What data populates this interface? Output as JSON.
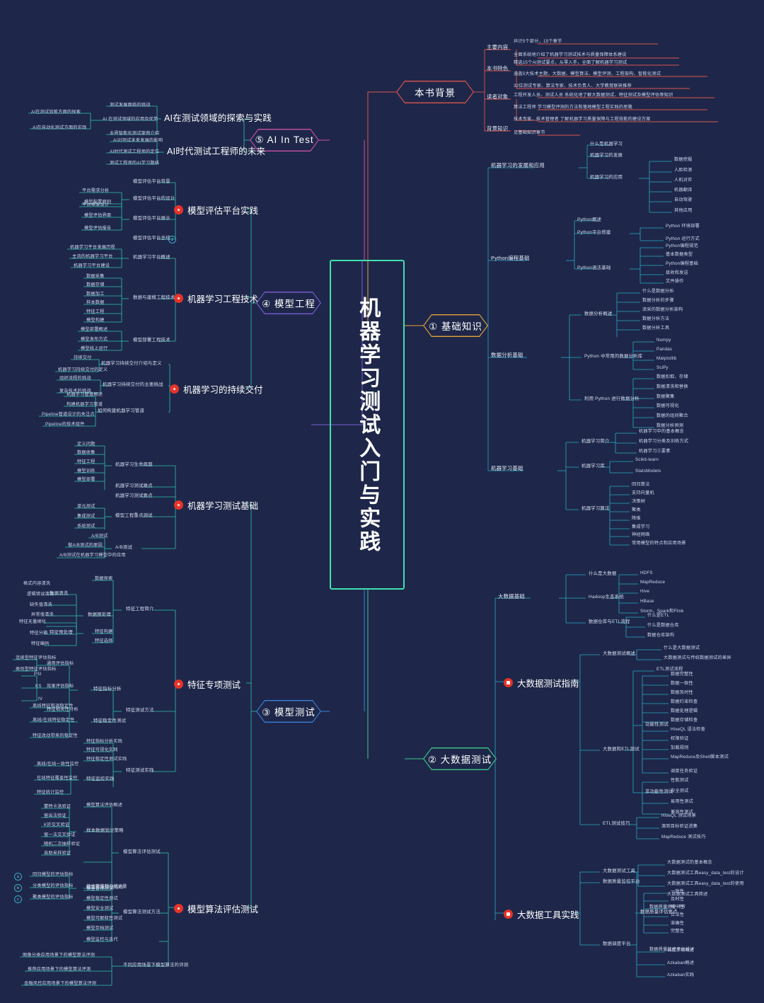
{
  "meta": {
    "title": "机器学习测试入门与实践",
    "bg_color": "#1e2749",
    "center_border_color": "#3fe0b0"
  },
  "center": {
    "label": "机器学习测试入门与实践"
  },
  "branches": [
    {
      "id": "b1",
      "label": "① 基础知识",
      "color": "#e8a13a"
    },
    {
      "id": "b2",
      "label": "② 大数据测试",
      "color": "#3fc98a"
    },
    {
      "id": "b3",
      "label": "③ 模型测试",
      "color": "#3a7fd5"
    },
    {
      "id": "b4",
      "label": "④ 模型工程",
      "color": "#7a5cd8"
    },
    {
      "id": "b5",
      "label": "⑤ AI In Test",
      "color": "#c94fa8"
    },
    {
      "id": "b0",
      "label": "本书背景",
      "color": "#d9544e"
    }
  ],
  "book_background": {
    "title": "本书背景",
    "groups": [
      {
        "label": "主要内容",
        "items": [
          "共计5个部分，15个章节",
          "全面系统地介绍了机器学习测试技术与质量保障体系建设"
        ]
      },
      {
        "label": "本书特色",
        "items": [
          "精选15个AI测试要点，从零入手，全面了解机器学习测试",
          "涵盖5大技术主题，大数据、模型算法、模型评测、工程架构、智能化测试",
          "32位测试专家、算法专家、技术负责人、大学教授联袂推荐"
        ]
      },
      {
        "label": "读者对象",
        "items": [
          "工程开发人员、测试人员      系统化地了解大数据测试、特征测试及模型评估等知识",
          "算法工程师      学习模型评测的方法和落地模型工程实践的思路",
          "技术专家、技术管理者      了解机器学习质量保障与工程效能的建设方案"
        ]
      },
      {
        "label": "背景知识",
        "items": [
          "见基础知识章节"
        ]
      }
    ]
  },
  "basic_knowledge": {
    "title": "① 基础知识",
    "sections": [
      {
        "label": "机器学习的发展和应用",
        "children": [
          {
            "label": "什么是机器学习",
            "items": []
          },
          {
            "label": "机器学习的发展",
            "items": []
          },
          {
            "label": "机器学习的应用",
            "items": [
              "数据挖掘",
              "人脸检测",
              "人机对弈",
              "机器翻译",
              "自动驾驶",
              "其他应用"
            ]
          }
        ]
      },
      {
        "label": "Python编程基础",
        "children": [
          {
            "label": "Python概述",
            "items": []
          },
          {
            "label": "Python平台搭建",
            "items": [
              "Python 环境部署",
              "Python 运行方式"
            ]
          },
          {
            "label": "Python语法基础",
            "items": [
              "Python编程规范",
              "基本数据类型",
              "Python编程基础",
              "接收和发送",
              "文件操作"
            ]
          }
        ]
      },
      {
        "label": "数据分析基础",
        "children": [
          {
            "label": "数据分析概述",
            "items": [
              "什么是数据分析",
              "数据分析的步骤",
              "流采的数据分析架构",
              "数据分析方法",
              "数据分析工具"
            ]
          },
          {
            "label": "Python 中常用的数据分析库",
            "items": [
              "Numpy",
              "Pandas",
              "Matplotlib",
              "SciPy"
            ]
          },
          {
            "label": "利用 Python 进行数据分析",
            "items": [
              "数据扣取、存储",
              "数据清洗和替换",
              "数据聚集",
              "数据可视化",
              "数据的组间聚合",
              "数据分析预测"
            ]
          }
        ]
      },
      {
        "label": "机器学习基础",
        "children": [
          {
            "label": "机器学习简介",
            "items": [
              "机器学习中的基本概念",
              "机器学习分类及训练方式",
              "机器学习三要素"
            ]
          },
          {
            "label": "机器学习库",
            "items": [
              "Scikit-learn",
              "StatsModels"
            ]
          },
          {
            "label": "机器学习算法",
            "items": [
              "回归算法",
              "支持向量机",
              "决策树",
              "聚类",
              "降维",
              "集成学习",
              "神经网络",
              "常用模型的特点和应用场景"
            ]
          }
        ]
      }
    ]
  },
  "big_data_testing": {
    "title": "② 大数据测试",
    "sections": [
      {
        "label": "大数据基础",
        "children": [
          {
            "label": "什么是大数据",
            "items": []
          },
          {
            "label": "Hadoop生态系统",
            "items": [
              "HDFS",
              "MapReduce",
              "Hive",
              "HBase",
              "Storm、Spark和Flink"
            ]
          },
          {
            "label": "数据仓库与ETL流程",
            "items": [
              "什么是ETL",
              "什么是数据仓库",
              "数据仓库架构"
            ]
          }
        ]
      },
      {
        "label": "大数据测试指南",
        "is_dot": true,
        "children": [
          {
            "label": "大数据测试概述",
            "items": [
              "什么是大数据测试",
              "大数据测试与传统数据测试的差异"
            ]
          },
          {
            "label": "大数据和ETL测试",
            "items": [
              "ETL测试流程"
            ],
            "subgroups": [
              {
                "label": "功能性测试",
                "items": [
                  "数据完整性",
                  "数据一致性",
                  "数据及时性",
                  "数据约束检查",
                  "数据处理逻辑",
                  "数据存储检查",
                  "HiveQL 语法检查",
                  "权限验证",
                  "加载规则",
                  "MapReduce及Shell脚本测试",
                  "调度任务验证"
                ]
              },
              {
                "label": "非功能性测试",
                "items": [
                  "性能测试",
                  "安全测试",
                  "易用性测试",
                  "兼容性测试"
                ]
              }
            ]
          },
          {
            "label": "ETL测试技巧",
            "items": [
              "HiveQL 测试场景",
              "源到目标验证进集",
              "MapReduce 测试技巧"
            ]
          }
        ]
      },
      {
        "label": "大数据工具实践",
        "is_dot": true,
        "children": [
          {
            "label": "大数据测试工具",
            "items": [
              "大数据测试的基本概念",
              "大数据测试工具easy_data_test的设计",
              "大数据测试工具easy_data_test的使用",
              "大数据测试工具简述"
            ]
          },
          {
            "label": "数据质量监控平台",
            "items": [
              "数据质量把控环节",
              "数据质量监控平台设计"
            ],
            "subgroups": [
              {
                "label": "数据质量评估要点",
                "items": [
                  "一致性",
                  "及时性",
                  "唯一性",
                  "合法性",
                  "准确性",
                  "完整性"
                ]
              }
            ]
          },
          {
            "label": "数据调度平台",
            "items": [
              "调度系统概述",
              "Azkaban概述",
              "Azkaban实践"
            ]
          }
        ]
      }
    ]
  },
  "model_testing": {
    "title": "③ 模型测试",
    "sections": [
      {
        "label": "机器学习测试基础",
        "is_dot": true,
        "children": [
          {
            "label": "机器学习生命周期",
            "items": [
              "定义问题",
              "数据收集",
              "特征工程",
              "模型训练",
              "模型部署"
            ]
          },
          {
            "label": "机器学习测试难点",
            "items": []
          },
          {
            "label": "机器学习测试要点",
            "items": []
          },
          {
            "label": "模型工程重点测试",
            "items": [
              "单元测试",
              "集成测试",
              "系统测试"
            ]
          },
          {
            "label": "A/B测试",
            "items": [
              "A/B测试",
              "做A/B测试的原因",
              "A/B测试在机器学习模型中的应用"
            ]
          }
        ]
      },
      {
        "label": "特征专项测试",
        "is_dot": true,
        "children": [
          {
            "label": "特征工程简介",
            "items": [
              "数据探索",
              "特征构建",
              "特征选择"
            ],
            "subgroups": [
              {
                "label": "数据预处理",
                "items": []
              },
              {
                "label": "数据清洗",
                "items": [
                  "格式内容清洗",
                  "逻辑错误清洗",
                  "缺失值清洗",
                  "异常值清洗"
                ]
              },
              {
                "label": "特征预处理",
                "items": [
                  "特征无量纲化",
                  "特征分箱",
                  "特征编码"
                ]
              }
            ]
          },
          {
            "label": "特征测试方法",
            "items": [],
            "subgroups": [
              {
                "label": "特征指标分析",
                "items": [
                  "通用评估指标",
                  "效果评估指标",
                  "特征相关性分析"
                ],
                "leaves": [
                  "连续型特征评估指标",
                  "类别型特征评估指标",
                  "PSI",
                  "KS",
                  "IV"
                ]
              },
              {
                "label": "特征稳定性测试",
                "items": [
                  "离线特征和调稳定性",
                  "离线/在线特征稳定性",
                  "特征改动带来的稳定性"
                ]
              }
            ]
          },
          {
            "label": "特征测试实践",
            "items": [
              "特征指标分析实践",
              "特征可视化实践",
              "特征稳定性测试实践",
              "特征监控实践"
            ],
            "leaves": [
              "离线/在线一致性监控",
              "在线特征覆盖性监控",
              "特征统计监控"
            ]
          }
        ]
      },
      {
        "label": "模型算法评估测试",
        "is_dot": true,
        "children": [
          {
            "label": "模型算法评估测试",
            "items": [
              "模型算法评估概述",
              "统计学推断与统计量"
            ],
            "subgroups": [
              {
                "label": "样本数据划分策略",
                "items": [
                  "蒙特卡洛验证",
                  "留出法验证",
                  "K折交叉验证",
                  "留一法交叉验证",
                  "随机二次抽样验证",
                  "自助采样验证"
                ]
              },
              {
                "label": "模型算法评估指标",
                "items": [
                  "回归模型的评估指标",
                  "分类模型的评估指标",
                  "聚类模型的评估指标"
                ]
              }
            ]
          },
          {
            "label": "模型算法测试方法",
            "items": [
              "模型鲁棒测试",
              "模型稳定性测试",
              "模型安全测试",
              "模型可解释性测试",
              "模型存档测试",
              "模型监控与迭代"
            ]
          },
          {
            "label": "不同应用场景下模型算法的评测",
            "items": [
              "图像分类应用场景下的模型算法评测",
              "推荐应用场景下的模型算法评测",
              "金融风控应用场景下的模型算法评测"
            ]
          }
        ]
      }
    ]
  },
  "model_engineering": {
    "title": "④ 模型工程",
    "sections": [
      {
        "label": "模型评估平台实践",
        "is_dot": true,
        "children": [
          {
            "label": "模型评估平台背景",
            "items": []
          },
          {
            "label": "模型评估平台的设计",
            "items": [
              "平台需求分析",
              "平台框架设计"
            ]
          },
          {
            "label": "模型评估平台展示",
            "items": [
              "模型配置原则",
              "模型评估界面",
              "模型评估报告"
            ]
          },
          {
            "label": "模型评估平台总结",
            "items": []
          }
        ]
      },
      {
        "label": "机器学习工程技术",
        "is_dot": true,
        "children": [
          {
            "label": "机器学习平台概述",
            "items": [
              "机器学习平台发展历程",
              "主流的机器学习平台",
              "机器学习平台建设"
            ]
          },
          {
            "label": "数据与建模工程技术",
            "items": [
              "数据采集",
              "数据存储",
              "数据加工",
              "样本数据",
              "特征工程",
              "模型构建"
            ]
          },
          {
            "label": "模型部署工程技术",
            "items": [
              "模型部署概述",
              "模型发布方式",
              "模型线上运行"
            ]
          }
        ]
      },
      {
        "label": "机器学习的持续交付",
        "is_dot": true,
        "children": [
          {
            "label": "机器学习持续交付介绍与定义",
            "items": [
              "持续交付",
              "机器学习持续交付的定义"
            ]
          },
          {
            "label": "机器学习持续交付的主要挑战",
            "items": [
              "组织流程的挑战",
              "复杂技术的挑战"
            ]
          },
          {
            "label": "如何构建机器学习管道",
            "items": [
              "机器学习管道概述",
              "构建机器学习管道",
              "Pipeline管道设计的关注点",
              "Pipeline的技术组件"
            ]
          }
        ]
      }
    ]
  },
  "ai_in_test": {
    "title": "⑤ AI In Test",
    "sections": [
      {
        "label": "AI在测试领域的探索与实践",
        "children": [
          {
            "label": "测试发展面临的挑战",
            "items": []
          },
          {
            "label": "AI 在测试领域的应用及优势",
            "items": []
          },
          {
            "label": "业界智能化测试案例介绍",
            "items": [
              "AI在测试效能方面的探索",
              "AI在自动化测试方面的实践"
            ]
          }
        ]
      },
      {
        "label": "AI时代测试工程师的未来",
        "children": [
          {
            "label": "AI对测试未来发展的影响",
            "items": []
          },
          {
            "label": "AI时代测试工程师的定位",
            "items": []
          },
          {
            "label": "测试工程师的AI学习路线",
            "items": []
          }
        ]
      }
    ]
  }
}
